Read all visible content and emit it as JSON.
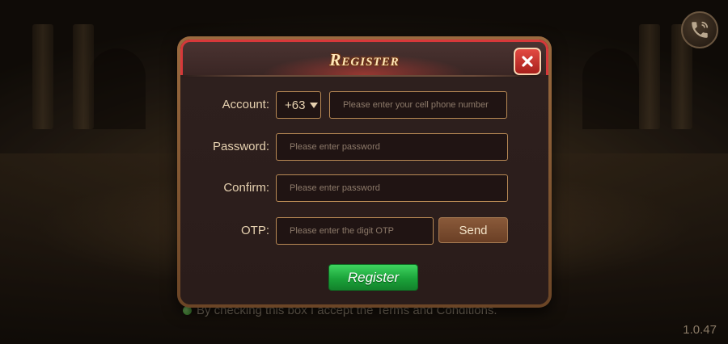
{
  "dialog": {
    "title": "Register",
    "close_icon": "close-icon"
  },
  "form": {
    "account": {
      "label": "Account:",
      "country_code": "+63",
      "placeholder": "Please enter your cell phone number"
    },
    "password": {
      "label": "Password:",
      "placeholder": "Please enter password"
    },
    "confirm": {
      "label": "Confirm:",
      "placeholder": "Please enter password"
    },
    "otp": {
      "label": "OTP:",
      "placeholder": "Please enter the digit OTP",
      "send_label": "Send"
    },
    "submit_label": "Register"
  },
  "footer": {
    "terms_text": "By checking this box I accept the Terms and Conditions.",
    "version": "1.0.47"
  },
  "icons": {
    "call": "phone-call-icon",
    "dropdown": "triangle-down-icon"
  },
  "colors": {
    "header_border": "#d7383a",
    "field_border": "#b98a55",
    "register_green": "#1ba33a",
    "title_text": "#ffe7b8"
  }
}
